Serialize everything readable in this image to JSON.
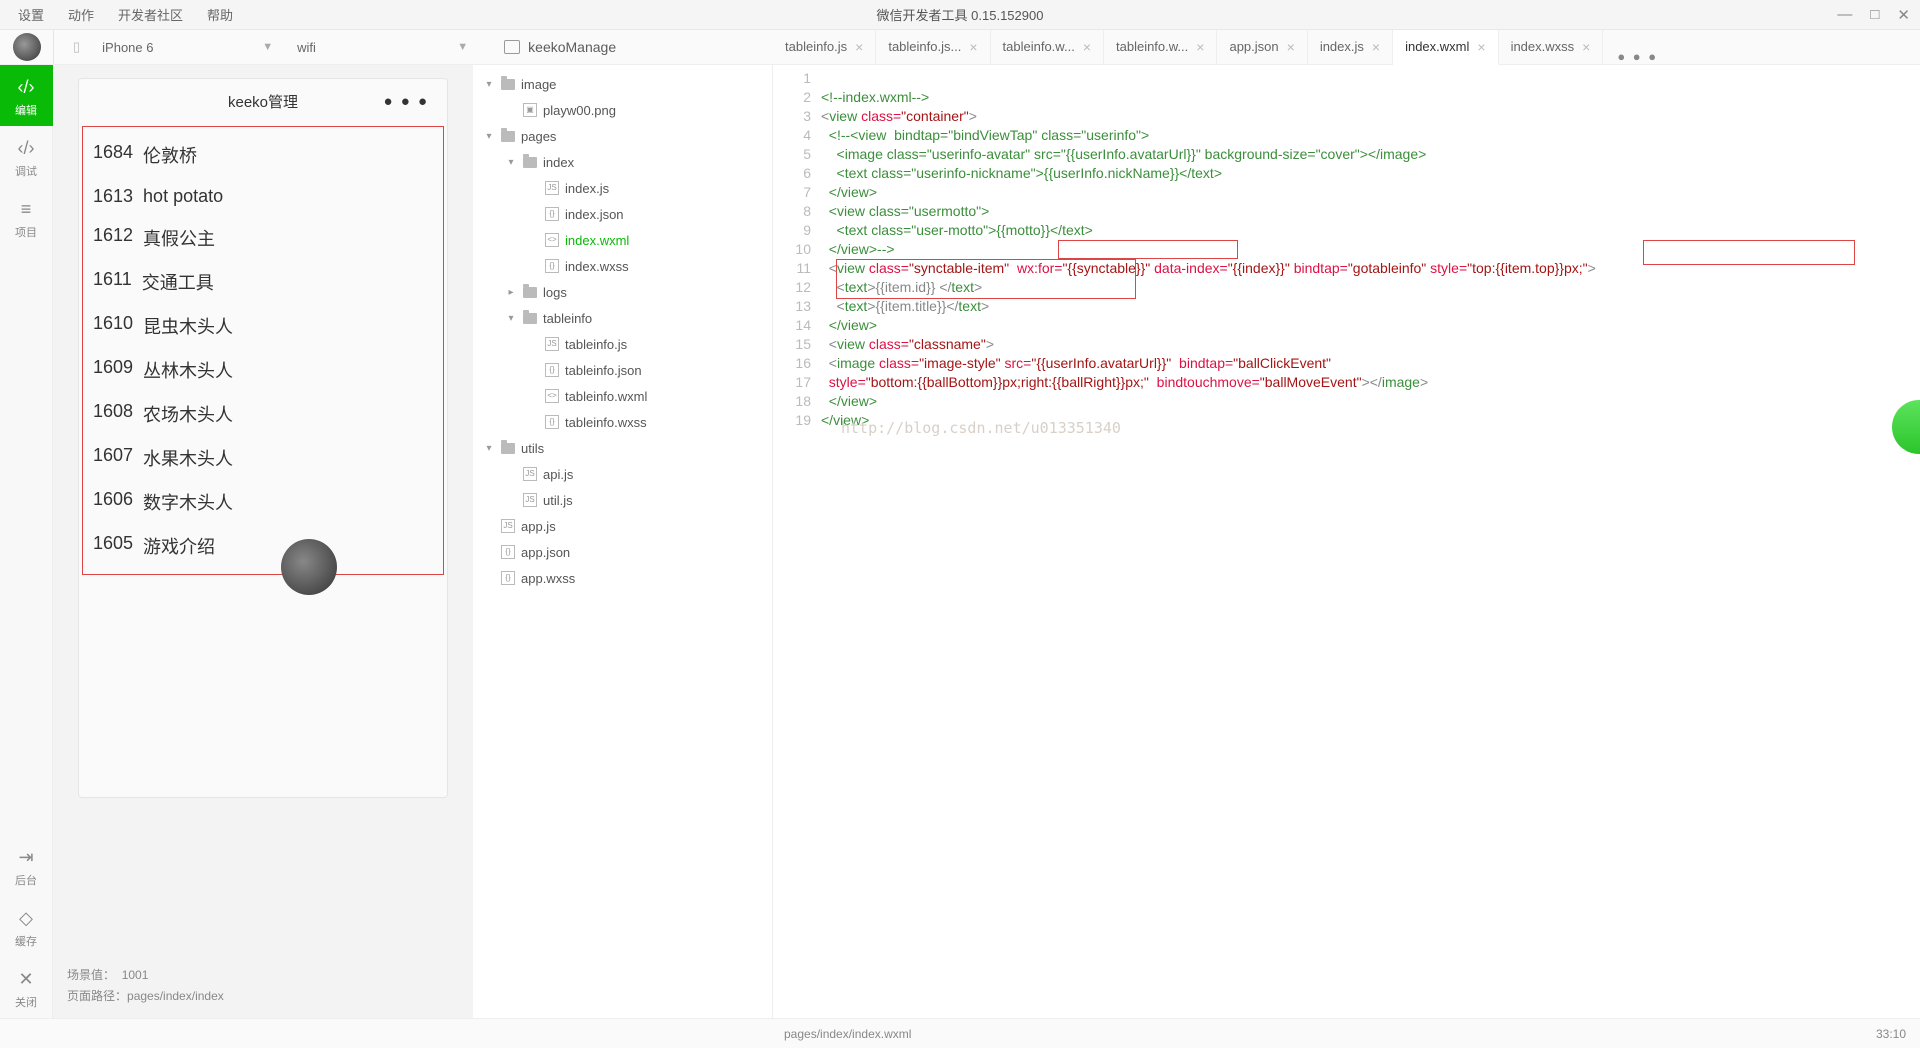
{
  "menu": {
    "settings": "设置",
    "actions": "动作",
    "community": "开发者社区",
    "help": "帮助"
  },
  "app_title": "微信开发者工具 0.15.152900",
  "win": {
    "min": "—",
    "max": "□",
    "close": "✕"
  },
  "toolbar": {
    "device": "iPhone 6",
    "network": "wifi",
    "project": "keekoManage"
  },
  "sidebar": {
    "edit": {
      "icon": "‹/›",
      "label": "编辑"
    },
    "debug": {
      "icon": "‹/›",
      "label": "调试"
    },
    "project": {
      "icon": "≡",
      "label": "项目"
    },
    "background": {
      "icon": "⇥",
      "label": "后台"
    },
    "cache": {
      "icon": "◇",
      "label": "缓存"
    },
    "close": {
      "icon": "✕",
      "label": "关闭"
    }
  },
  "phone": {
    "title": "keeko管理",
    "dots": "● ● ●",
    "rows": [
      {
        "id": "1684",
        "title": "伦敦桥"
      },
      {
        "id": "1613",
        "title": "hot potato"
      },
      {
        "id": "1612",
        "title": "真假公主"
      },
      {
        "id": "1611",
        "title": "交通工具"
      },
      {
        "id": "1610",
        "title": "昆虫木头人"
      },
      {
        "id": "1609",
        "title": "丛林木头人"
      },
      {
        "id": "1608",
        "title": "农场木头人"
      },
      {
        "id": "1607",
        "title": "水果木头人"
      },
      {
        "id": "1606",
        "title": "数字木头人"
      },
      {
        "id": "1605",
        "title": "游戏介绍"
      }
    ]
  },
  "preview_footer": {
    "scene_label": "场景值：",
    "scene_val": "1001",
    "path_label": "页面路径：",
    "path_val": "pages/index/index"
  },
  "tree": [
    {
      "d": 0,
      "t": "folder",
      "caret": "▾",
      "name": "image"
    },
    {
      "d": 1,
      "t": "img",
      "caret": "",
      "name": "playw00.png"
    },
    {
      "d": 0,
      "t": "folder",
      "caret": "▾",
      "name": "pages"
    },
    {
      "d": 1,
      "t": "folder",
      "caret": "▾",
      "name": "index"
    },
    {
      "d": 2,
      "t": "js",
      "caret": "",
      "name": "index.js"
    },
    {
      "d": 2,
      "t": "json",
      "caret": "",
      "name": "index.json"
    },
    {
      "d": 2,
      "t": "wxml",
      "caret": "",
      "name": "index.wxml",
      "sel": true
    },
    {
      "d": 2,
      "t": "wxss",
      "caret": "",
      "name": "index.wxss"
    },
    {
      "d": 1,
      "t": "folder",
      "caret": "▸",
      "name": "logs"
    },
    {
      "d": 1,
      "t": "folder",
      "caret": "▾",
      "name": "tableinfo"
    },
    {
      "d": 2,
      "t": "js",
      "caret": "",
      "name": "tableinfo.js"
    },
    {
      "d": 2,
      "t": "json",
      "caret": "",
      "name": "tableinfo.json"
    },
    {
      "d": 2,
      "t": "wxml",
      "caret": "",
      "name": "tableinfo.wxml"
    },
    {
      "d": 2,
      "t": "wxss",
      "caret": "",
      "name": "tableinfo.wxss"
    },
    {
      "d": 0,
      "t": "folder",
      "caret": "▾",
      "name": "utils"
    },
    {
      "d": 1,
      "t": "js",
      "caret": "",
      "name": "api.js"
    },
    {
      "d": 1,
      "t": "js",
      "caret": "",
      "name": "util.js"
    },
    {
      "d": 0,
      "t": "js",
      "caret": "",
      "name": "app.js"
    },
    {
      "d": 0,
      "t": "json",
      "caret": "",
      "name": "app.json"
    },
    {
      "d": 0,
      "t": "wxss",
      "caret": "",
      "name": "app.wxss"
    }
  ],
  "tabs": [
    {
      "label": "tableinfo.js",
      "close": true
    },
    {
      "label": "tableinfo.js...",
      "close": true
    },
    {
      "label": "tableinfo.w...",
      "close": true
    },
    {
      "label": "tableinfo.w...",
      "close": true
    },
    {
      "label": "app.json",
      "close": true
    },
    {
      "label": "index.js",
      "close": true
    },
    {
      "label": "index.wxml",
      "close": true,
      "active": true
    },
    {
      "label": "index.wxss",
      "close": true
    }
  ],
  "tabs_more": "● ● ●",
  "code_lines": [
    "1",
    "2",
    "3",
    "4",
    "5",
    "6",
    "7",
    "8",
    "9",
    "10",
    "11",
    "12",
    "13",
    "14",
    "15",
    "16",
    "17",
    "18",
    "19"
  ],
  "code_text": {
    "l1": "<!--index.wxml-->",
    "l2a": "<",
    "l2b": "view",
    "l2c": " class=",
    "l2d": "\"container\"",
    "l2e": ">",
    "l3": "  <!--<view  bindtap=\"bindViewTap\" class=\"userinfo\">",
    "l4": "    <image class=\"userinfo-avatar\" src=\"{{userInfo.avatarUrl}}\" background-size=\"cover\"></image>",
    "l5": "    <text class=\"userinfo-nickname\">{{userInfo.nickName}}</text>",
    "l6": "  </view>",
    "l7": "  <view class=\"usermotto\">",
    "l8": "    <text class=\"user-motto\">{{motto}}</text>",
    "l9": "  </view>-->",
    "l10a": "  <",
    "l10b": "view",
    "l10c": " class=",
    "l10d": "\"synctable-item\"",
    "l10e": "  ",
    "l10f": "wx:for=",
    "l10g": "\"{{synctable}}\"",
    "l10h": " data-index=",
    "l10i": "\"{{index}}\"",
    "l10j": " bindtap=",
    "l10k": "\"gotableinfo\"",
    "l10l": " ",
    "l10m": "style=",
    "l10n": "\"top:{{item.top}}px;\"",
    "l10o": ">",
    "l11a": "    <",
    "l11b": "text",
    "l11c": ">{{item.id}} </",
    "l11d": "text",
    "l11e": ">",
    "l12a": "    <",
    "l12b": "text",
    "l12c": ">{{item.title}}</",
    "l12d": "text",
    "l12e": ">",
    "l13": "  </view>",
    "l14a": "  <",
    "l14b": "view",
    "l14c": " class=",
    "l14d": "\"classname\"",
    "l14e": ">",
    "l15a": "  <",
    "l15b": "image",
    "l15c": " class=",
    "l15d": "\"image-style\"",
    "l15e": " src=",
    "l15f": "\"{{userInfo.avatarUrl}}\"",
    "l15g": "  bindtap=",
    "l15h": "\"ballClickEvent\"",
    "l16a": "  style=",
    "l16b": "\"bottom:{{ballBottom}}px;right:{{ballRight}}px;\"",
    "l16c": "  bindtouchmove=",
    "l16d": "\"ballMoveEvent\"",
    "l16e": "></",
    "l16f": "image",
    "l16g": ">",
    "l17": "  </view>",
    "l18": "</view>"
  },
  "watermark": "http://blog.csdn.net/u013351340",
  "status": {
    "path": "pages/index/index.wxml",
    "pos": "33:10"
  }
}
